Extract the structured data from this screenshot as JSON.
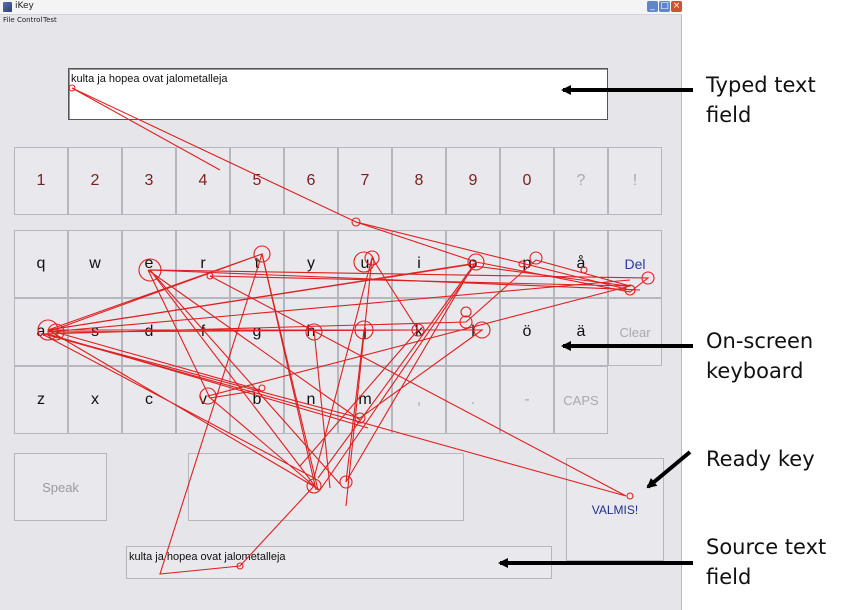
{
  "window": {
    "title": "iKey",
    "minimize_glyph": "_",
    "maximize_glyph": "□",
    "close_glyph": "×"
  },
  "menu": [
    "File",
    "Control",
    "Test"
  ],
  "typed_field": {
    "value": "kulta ja hopea ovat jalometalleja"
  },
  "keyboard": {
    "rows": [
      [
        "1",
        "2",
        "3",
        "4",
        "5",
        "6",
        "7",
        "8",
        "9",
        "0",
        "?",
        "!"
      ],
      [
        "q",
        "w",
        "e",
        "r",
        "t",
        "y",
        "u",
        "i",
        "o",
        "p",
        "å",
        "Del"
      ],
      [
        "a",
        "s",
        "d",
        "f",
        "g",
        "h",
        "j",
        "k",
        "l",
        "ö",
        "ä",
        "Clear"
      ],
      [
        "z",
        "x",
        "c",
        "v",
        "b",
        "n",
        "m",
        ",",
        ".",
        "-",
        "CAPS"
      ]
    ],
    "speak_label": "Speak",
    "ready_label": "VALMIS!"
  },
  "source_field": {
    "value": "kulta ja hopea ovat jalometalleja"
  },
  "annotations": {
    "typed_text_field": "Typed text field",
    "on_screen_keyboard": "On-screen keyboard",
    "ready_key": "Ready key",
    "source_text_field": "Source text field"
  },
  "colors": {
    "gaze_path": "#e02020",
    "window_bg": "#e6e6ea",
    "key_bg": "#e8e8ed",
    "ready_text": "#23308a",
    "number_text": "#7a1f1f"
  }
}
